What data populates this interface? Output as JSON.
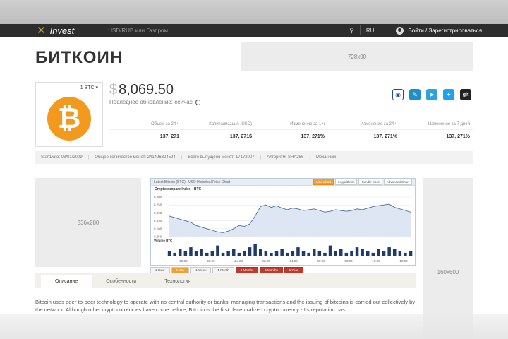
{
  "nav": {
    "logo_text": "Invest",
    "search_placeholder": "USD/RUB или Газпром",
    "lang": "RU",
    "login": "Войти / Зарегистрироваться"
  },
  "page": {
    "title": "БИТКОИН",
    "unit": "1 BTC ▾",
    "currency_symbol": "$",
    "price": "8,069.50",
    "update_label": "Последнее обновление: сейчас"
  },
  "ads": {
    "top": "728x90",
    "left": "336x280",
    "right": "160x600"
  },
  "socials": [
    "steemit-icon",
    "livejournal-icon",
    "telegram-icon",
    "twitter-icon",
    "git-icon"
  ],
  "stats": {
    "headers": [
      "Объем за 24 ч",
      "Капитализация (USD)",
      "Изменение за 1 ч",
      "Изменение за 24 ч",
      "Изменение за 7 дней"
    ],
    "values": [
      "137, 271",
      "137, 271$",
      "137, 271%",
      "137, 271%",
      "137, 271%"
    ]
  },
  "meta": {
    "start_date": "StartDate: 03/01/2009",
    "total_coins": "Общее количество монет: 241426324594",
    "issued": "Всего выпущено монет: 17172007",
    "algorithm": "Алгоритм: SHA256",
    "mechanism": "Механизм"
  },
  "chart": {
    "header_title": "Latest Bitcoin (BTC) - USD Historical Price Chart",
    "buttons": [
      "Line Chart",
      "Logarithmic",
      "Candle Stick",
      "Advanced Chart"
    ],
    "subtitle": "Cryptocompare Index - BTC",
    "volume_label": "Volume BTC",
    "ranges": [
      "1 Hour",
      "1 Day",
      "1 Week",
      "1 Month",
      "3 Months",
      "6 Months",
      "1 Year"
    ]
  },
  "chart_data": {
    "type": "area",
    "title": "Cryptocompare Index - BTC",
    "x_ticks": [
      "20:00",
      "22:00",
      "Jul 28",
      "02:00",
      "04:00",
      "06:00",
      "08:00",
      "10:00",
      "12:00"
    ],
    "y_ticks": [
      "8,050",
      "8,100",
      "8,150",
      "8,200",
      "8,250",
      "8,300"
    ],
    "ylim": [
      8050,
      8300
    ],
    "values": [
      8180,
      8170,
      8160,
      8150,
      8140,
      8120,
      8110,
      8100,
      8090,
      8080,
      8075,
      8085,
      8100,
      8120,
      8115,
      8130,
      8180,
      8240,
      8250,
      8235,
      8245,
      8230,
      8220,
      8230,
      8225,
      8215,
      8220,
      8225,
      8215,
      8205,
      8210,
      8220,
      8215,
      8210,
      8215,
      8225,
      8220,
      8230,
      8240,
      8245,
      8250,
      8255,
      8235,
      8225,
      8215,
      8205
    ],
    "volume": [
      3,
      2,
      4,
      3,
      5,
      3,
      4,
      2,
      3,
      6,
      2,
      3,
      4,
      2,
      3,
      5,
      7,
      4,
      3,
      2,
      3,
      4,
      2,
      3,
      5,
      3,
      2,
      4,
      3,
      2,
      6,
      3,
      4,
      2,
      3,
      5,
      4,
      3,
      2,
      4,
      3,
      5,
      4,
      3,
      2,
      3
    ],
    "grid": true
  },
  "tabs": [
    "Описание",
    "Особенности",
    "Технология"
  ],
  "description": "Bitcoin uses peer-to-peer technology to operate with no central authority or banks; managing transactions and the issuing of bitcoins is carried out collectively by the network. Although other cryptocurrencies have come before, Bitcoin is the first decentralized cryptocurrency - Its reputation has"
}
